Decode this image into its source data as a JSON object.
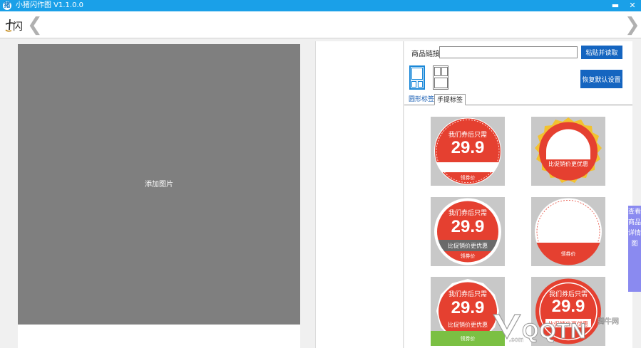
{
  "window": {
    "title": "小猪闪作图 V1.1.0.0",
    "app_icon": "猪",
    "minimize": "▬",
    "close": "✕"
  },
  "toolbar": {
    "logo_glyph": "闪",
    "back": "❮",
    "forward": "❯"
  },
  "canvas": {
    "drop_label": "添加图片"
  },
  "panel": {
    "link_label": "商品链接:",
    "link_value": "",
    "paste_button": "粘贴并读取",
    "restore_button": "恢复默认设置",
    "tabs": [
      "圆形标签",
      "手提标签"
    ]
  },
  "templates": [
    {
      "line1": "我们券后只需",
      "price": "29.9",
      "sub": "",
      "foot": "领券价"
    },
    {
      "line1": "",
      "price": "",
      "sub": "比促销价更优惠",
      "foot": ""
    },
    {
      "line1": "我们券后只需",
      "price": "29.9",
      "sub": "比促销价更优惠",
      "foot": "领券价"
    },
    {
      "line1": "",
      "price": "",
      "sub": "",
      "foot": "领券价"
    },
    {
      "line1": "我们券后只需",
      "price": "29.9",
      "sub": "比促销价更优惠",
      "foot": "领券价"
    },
    {
      "line1": "我们券后只需",
      "price": "29.9",
      "sub": "比促销价更优惠",
      "foot": ""
    }
  ],
  "side_tab": "查看商品详情图",
  "watermark": {
    "text": "QQTN",
    "sub": "腾牛网",
    "tld": ".com"
  },
  "colors": {
    "titlebar": "#1aa0e8",
    "accent_button": "#1565c0",
    "badge_red": "#e54030",
    "canvas_gray": "#7f7f7f",
    "side_tab": "#8a8af0"
  }
}
